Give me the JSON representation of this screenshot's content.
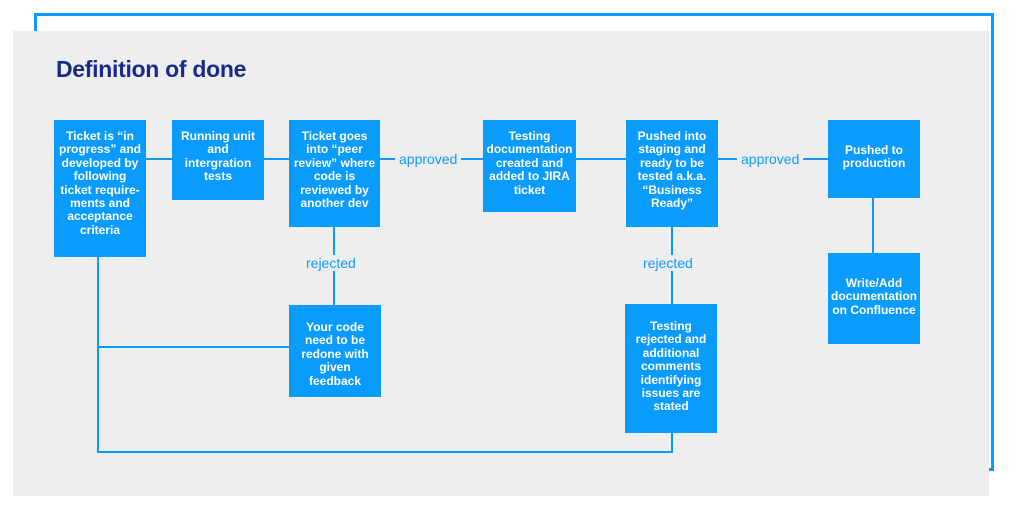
{
  "title": "Definition of done",
  "colors": {
    "accent": "#0a9bff",
    "title": "#1a2a8a",
    "panel": "#eeeeee"
  },
  "steps": [
    {
      "id": "in-progress",
      "text": "Ticket is “in progress” and developed by following ticket require-ments and acceptance criteria"
    },
    {
      "id": "unit-tests",
      "text": "Running unit and intergration tests"
    },
    {
      "id": "peer-review",
      "text": "Ticket goes into “peer review” where code is reviewed by another dev"
    },
    {
      "id": "testing-docs",
      "text": "Testing documentation created and added to JIRA ticket"
    },
    {
      "id": "staging",
      "text": "Pushed into staging and ready to be tested a.k.a. “Business Ready”"
    },
    {
      "id": "production",
      "text": "Pushed to production"
    },
    {
      "id": "redo-code",
      "text": "Your code need to be redone with given feedback"
    },
    {
      "id": "testing-rejected",
      "text": "Testing rejected and additional comments identifying issues are stated"
    },
    {
      "id": "confluence-docs",
      "text": "Write/Add documentation on Confluence"
    }
  ],
  "edge_labels": {
    "review_approved": "approved",
    "review_rejected": "rejected",
    "staging_approved": "approved",
    "staging_rejected": "rejected"
  }
}
